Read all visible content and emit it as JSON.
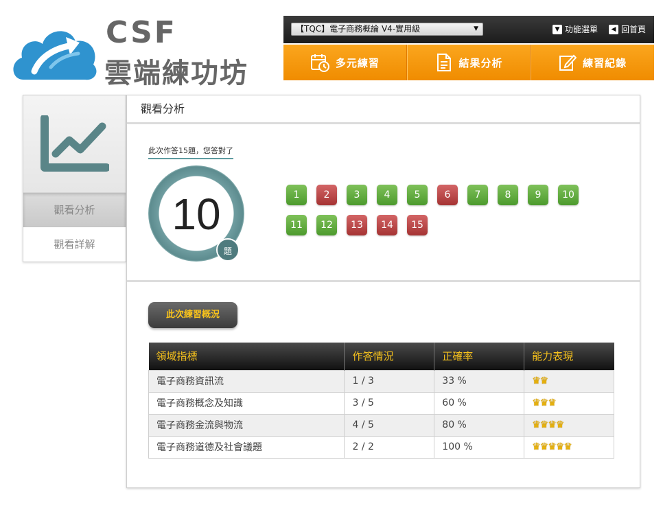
{
  "brand": {
    "line1": "CSF",
    "line2": "雲端練功坊"
  },
  "topbar": {
    "course_select": "【TQC】電子商務概論 V4-實用級",
    "menu_label": "功能選單",
    "home_label": "回首頁"
  },
  "nav": [
    {
      "label": "多元練習",
      "icon": "calendar-clock-icon"
    },
    {
      "label": "結果分析",
      "icon": "document-icon"
    },
    {
      "label": "練習紀錄",
      "icon": "edit-icon"
    }
  ],
  "sidebar": {
    "items": [
      {
        "label": "觀看分析",
        "active": true
      },
      {
        "label": "觀看詳解",
        "active": false
      }
    ]
  },
  "main": {
    "title": "觀看分析",
    "summary": "此次作答15題，您答對了",
    "score": "10",
    "score_unit": "題",
    "questions": [
      {
        "n": "1",
        "correct": true
      },
      {
        "n": "2",
        "correct": false
      },
      {
        "n": "3",
        "correct": true
      },
      {
        "n": "4",
        "correct": true
      },
      {
        "n": "5",
        "correct": true
      },
      {
        "n": "6",
        "correct": false
      },
      {
        "n": "7",
        "correct": true
      },
      {
        "n": "8",
        "correct": true
      },
      {
        "n": "9",
        "correct": true
      },
      {
        "n": "10",
        "correct": true
      },
      {
        "n": "11",
        "correct": true
      },
      {
        "n": "12",
        "correct": true
      },
      {
        "n": "13",
        "correct": false
      },
      {
        "n": "14",
        "correct": false
      },
      {
        "n": "15",
        "correct": false
      }
    ],
    "overview_button": "此次練習概況",
    "table": {
      "headers": [
        "領域指標",
        "作答情況",
        "正確率",
        "能力表現"
      ],
      "rows": [
        {
          "domain": "電子商務資訊流",
          "answered": "1 / 3",
          "rate": "33 %",
          "crowns": 2
        },
        {
          "domain": "電子商務概念及知識",
          "answered": "3 / 5",
          "rate": "60 %",
          "crowns": 3
        },
        {
          "domain": "電子商務金流與物流",
          "answered": "4 / 5",
          "rate": "80 %",
          "crowns": 4
        },
        {
          "domain": "電子商務道德及社會議題",
          "answered": "2 / 2",
          "rate": "100 %",
          "crowns": 5
        }
      ]
    }
  },
  "colors": {
    "orange": "#f7941d",
    "correct": "#5aa637",
    "wrong": "#b94444",
    "teal": "#5e8f92",
    "gold": "#f7c21c"
  }
}
